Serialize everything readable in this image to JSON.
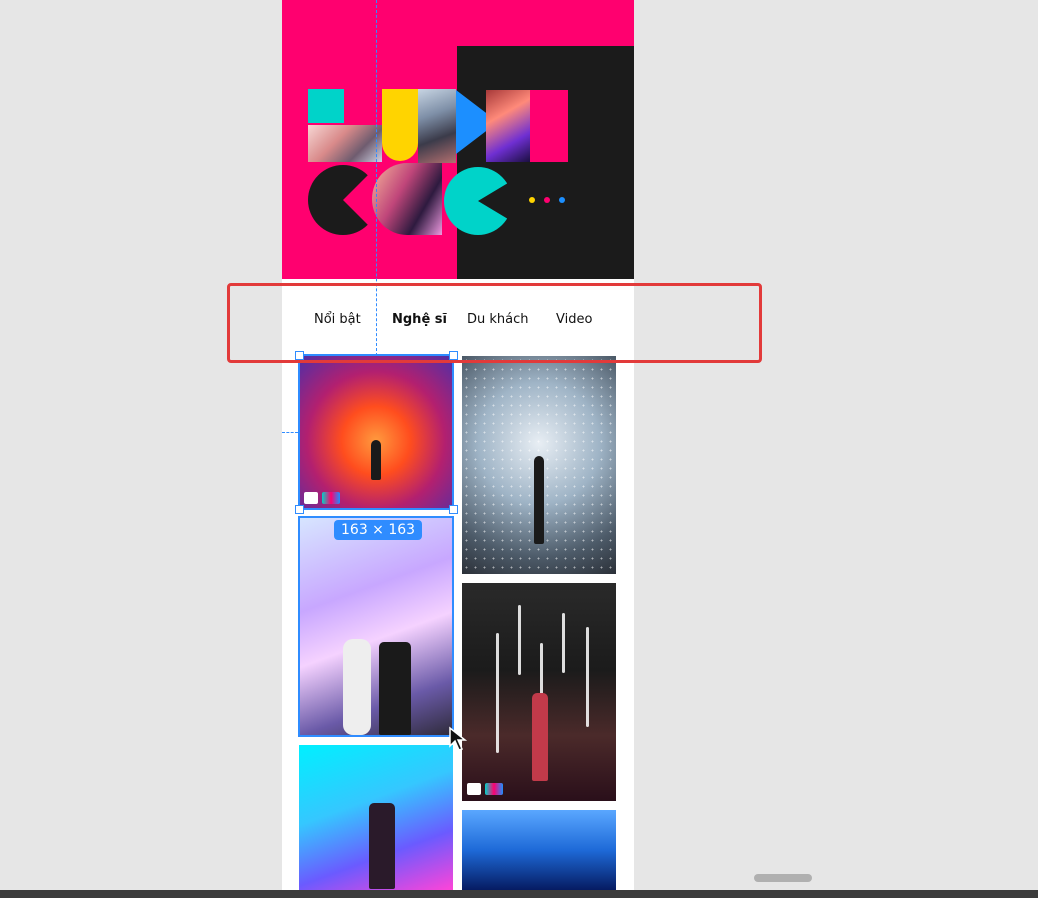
{
  "tabs": [
    {
      "label": "Nổi bật",
      "active": false
    },
    {
      "label": "Nghệ sĩ",
      "active": true
    },
    {
      "label": "Du khách",
      "active": false
    },
    {
      "label": "Video",
      "active": false
    }
  ],
  "selection": {
    "size_badge": "163 × 163"
  },
  "colors": {
    "hero_pink": "#ff006f",
    "hero_dark": "#1b1b1b",
    "teal": "#00d3c9",
    "yellow": "#ffd400",
    "blue": "#1c8fff",
    "selection_blue": "#2f8cff",
    "highlight_red": "#e23a3a"
  },
  "icons": [
    "cursor-arrow-icon",
    "resize-handle-icon"
  ]
}
